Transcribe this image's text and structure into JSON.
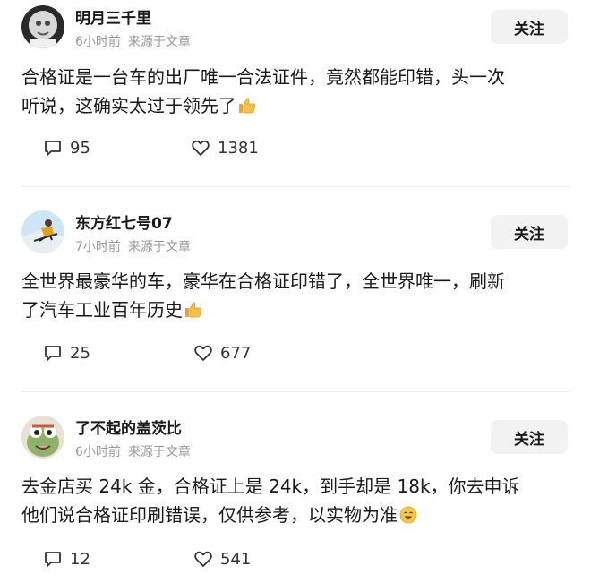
{
  "posts": [
    {
      "username": "明月三千里",
      "time": "6小时前",
      "source": "来源于文章",
      "follow_label": "关注",
      "content_lines": [
        "合格证是一台车的出厂唯一合法证件，竟然都能印错，头一次",
        "听说，这确实太过于领先了"
      ],
      "end_emoji": "thumbs-up-icon",
      "comments": "95",
      "likes": "1381"
    },
    {
      "username": "东方红七号07",
      "time": "7小时前",
      "source": "来源于文章",
      "follow_label": "关注",
      "content_lines": [
        "全世界最豪华的车，豪华在合格证印错了，全世界唯一，刷新",
        "了汽车工业百年历史"
      ],
      "end_emoji": "thumbs-up-icon",
      "comments": "25",
      "likes": "677"
    },
    {
      "username": "了不起的盖茨比",
      "time": "6小时前",
      "source": "来源于文章",
      "follow_label": "关注",
      "content_lines": [
        "去金店买 24k 金，合格证上是 24k，到手却是 18k，你去申诉",
        "他们说合格证印刷错误，仅供参考，以实物为准"
      ],
      "end_emoji": "grinning-face-icon",
      "comments": "12",
      "likes": "541"
    }
  ]
}
